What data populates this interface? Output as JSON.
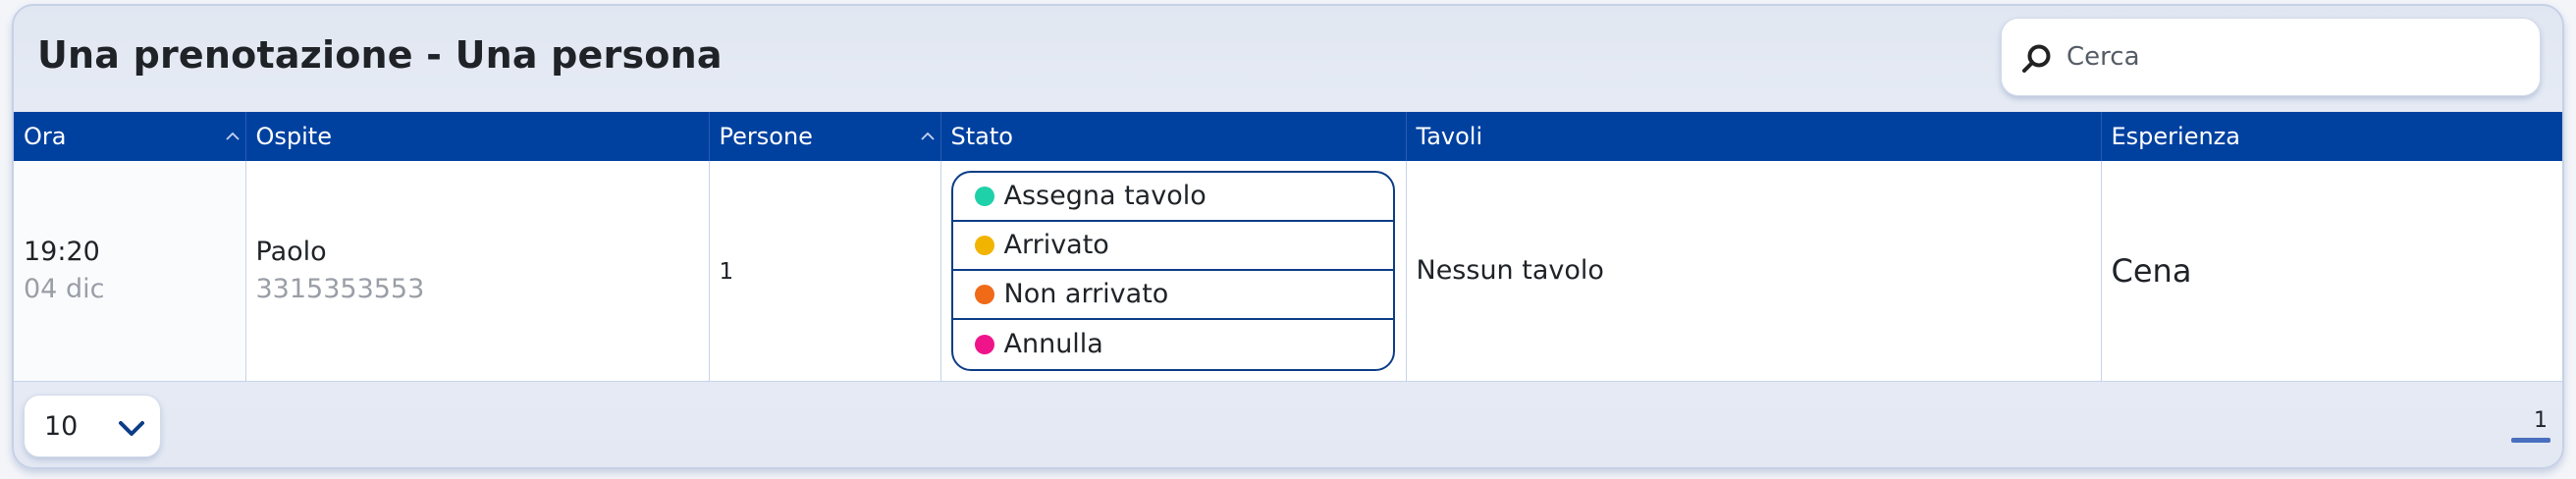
{
  "header": {
    "title": "Una prenotazione - Una persona",
    "search_placeholder": "Cerca"
  },
  "table": {
    "columns": [
      {
        "label": "Ora",
        "sortable": true
      },
      {
        "label": "Ospite",
        "sortable": false
      },
      {
        "label": "Persone",
        "sortable": true
      },
      {
        "label": "Stato",
        "sortable": false
      },
      {
        "label": "Tavoli",
        "sortable": false
      },
      {
        "label": "Esperienza",
        "sortable": false
      }
    ],
    "rows": [
      {
        "time": "19:20",
        "date": "04 dic",
        "guest_name": "Paolo",
        "guest_phone": "3315353553",
        "people": "1",
        "status_options": [
          {
            "label": "Assegna tavolo",
            "color": "#1fd1a8"
          },
          {
            "label": "Arrivato",
            "color": "#f1b400"
          },
          {
            "label": "Non arrivato",
            "color": "#f06a18"
          },
          {
            "label": "Annulla",
            "color": "#f0148a"
          }
        ],
        "tables": "Nessun tavolo",
        "experience": "Cena"
      }
    ]
  },
  "footer": {
    "page_size": "10",
    "current_page": "1"
  },
  "colors": {
    "header_bg": "#0041a0",
    "accent": "#0c3d86"
  },
  "icons": {
    "search": "search-icon",
    "sort": "chevron-up-icon",
    "page_size": "chevron-down-icon"
  }
}
